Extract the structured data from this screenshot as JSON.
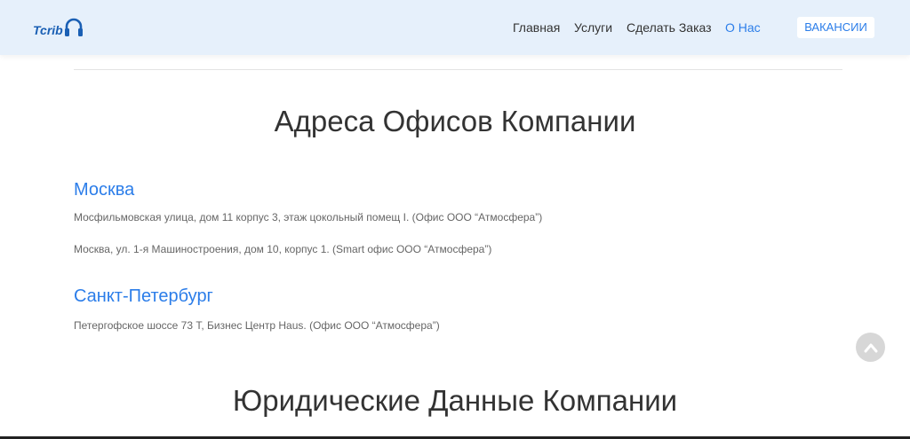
{
  "header": {
    "logo_text": "Tcrib",
    "nav": [
      "Главная",
      "Услуги",
      "Сделать Заказ",
      "О Нас"
    ],
    "cta": "ВАКАНСИИ",
    "active_color": "#2b7de9"
  },
  "offices": {
    "title": "Адреса Офисов Компании",
    "cities": [
      {
        "name": "Москва",
        "addresses": [
          "Мосфильмовская улица, дом 11 корпус 3, этаж цокольный помещ I. (Офис ООО “Атмосфера”)",
          "Москва, ул. 1-я Машиностроения, дом 10, корпус 1. (Smart офис ООО “Атмосфера”)"
        ]
      },
      {
        "name": "Санкт-Петербург",
        "addresses": [
          "Петергофское шоссе 73 Т, Бизнес Центр Haus. (Офис ООО “Атмосфера”)"
        ]
      }
    ]
  },
  "legal": {
    "title": "Юридические Данные Компании"
  },
  "icons": {
    "logo": "headphones-icon",
    "scroll_top": "chevron-up-icon"
  }
}
